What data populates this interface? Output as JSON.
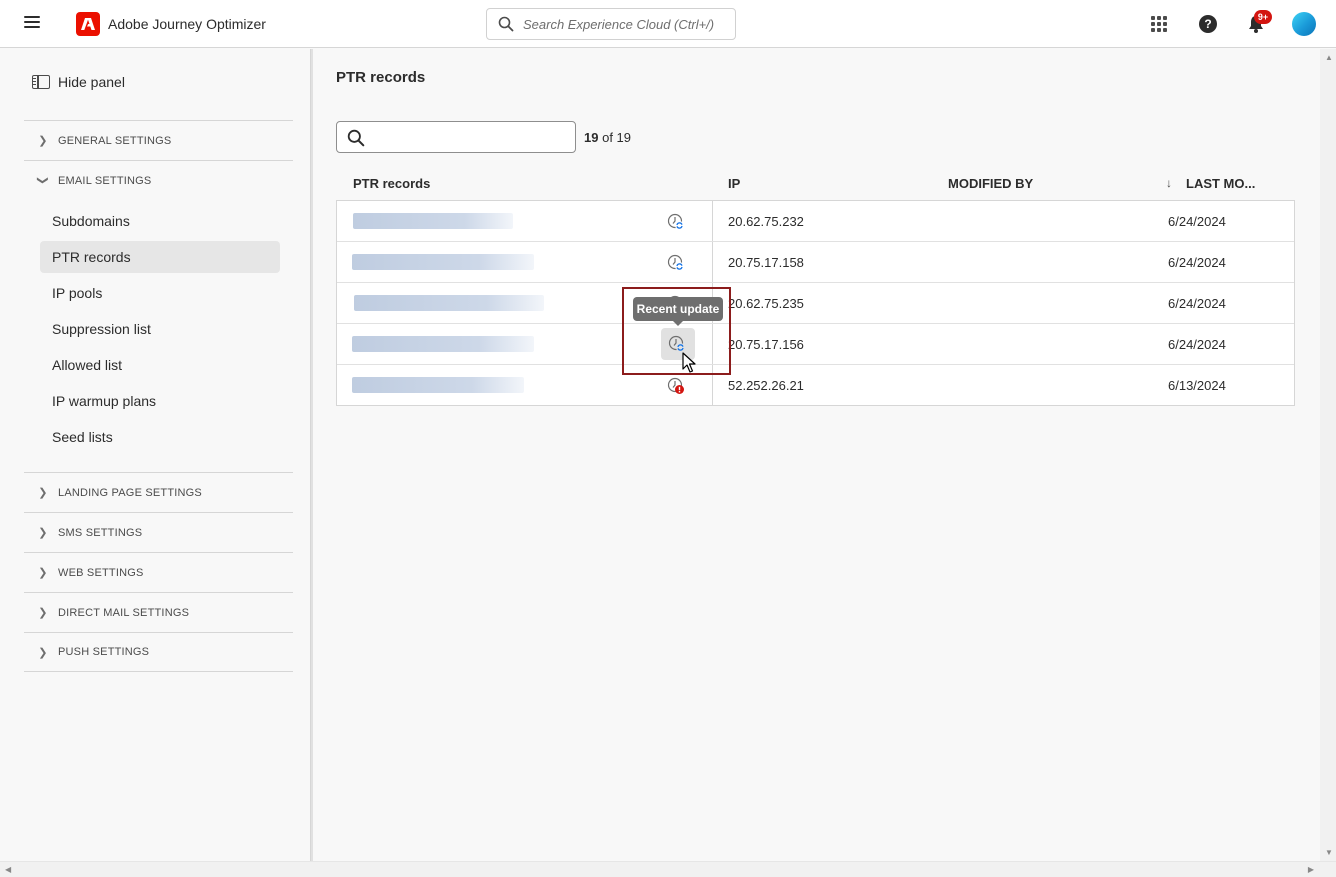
{
  "header": {
    "app_title": "Adobe Journey Optimizer",
    "search_placeholder": "Search Experience Cloud (Ctrl+/)",
    "help_label": "?",
    "notifications_badge": "9+",
    "brand_color": "#eb1000"
  },
  "sidebar": {
    "hide_panel_label": "Hide panel",
    "sections": [
      {
        "label": "GENERAL SETTINGS",
        "expanded": false
      },
      {
        "label": "EMAIL SETTINGS",
        "expanded": true
      },
      {
        "label": "LANDING PAGE SETTINGS",
        "expanded": false
      },
      {
        "label": "SMS SETTINGS",
        "expanded": false
      },
      {
        "label": "WEB SETTINGS",
        "expanded": false
      },
      {
        "label": "DIRECT MAIL SETTINGS",
        "expanded": false
      },
      {
        "label": "PUSH SETTINGS",
        "expanded": false
      }
    ],
    "email_items": [
      {
        "label": "Subdomains"
      },
      {
        "label": "PTR records",
        "active": true
      },
      {
        "label": "IP pools"
      },
      {
        "label": "Suppression list"
      },
      {
        "label": "Allowed list"
      },
      {
        "label": "IP warmup plans"
      },
      {
        "label": "Seed lists"
      }
    ]
  },
  "main": {
    "page_title": "PTR records",
    "result_count": "19",
    "result_total": "of 19",
    "columns": {
      "name": "PTR records",
      "ip": "IP",
      "modified_by": "MODIFIED BY",
      "last_modified": "LAST MO..."
    },
    "rows": [
      {
        "ip": "20.62.75.232",
        "modified_by": "",
        "date": "6/24/2024",
        "status_icon": "recent-update-icon"
      },
      {
        "ip": "20.75.17.158",
        "modified_by": "",
        "date": "6/24/2024",
        "status_icon": "recent-update-icon"
      },
      {
        "ip": "20.62.75.235",
        "modified_by": "",
        "date": "6/24/2024",
        "status_icon": "recent-update-icon"
      },
      {
        "ip": "20.75.17.156",
        "modified_by": "",
        "date": "6/24/2024",
        "status_icon": "recent-update-icon"
      },
      {
        "ip": "52.252.26.21",
        "modified_by": "",
        "date": "6/13/2024",
        "status_icon": "failed-update-icon"
      }
    ],
    "tooltip": "Recent update"
  }
}
